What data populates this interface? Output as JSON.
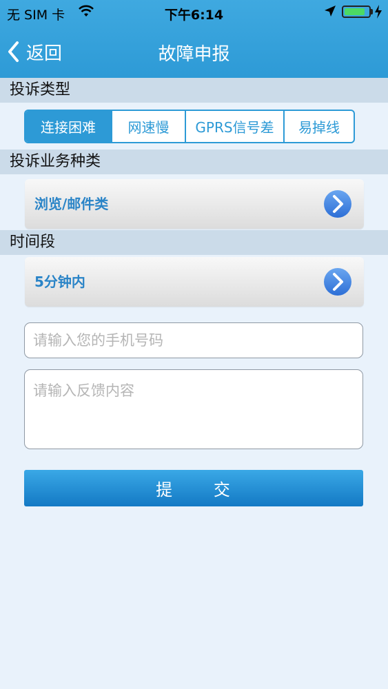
{
  "status_bar": {
    "carrier": "无 SIM 卡",
    "time": "下午6:14",
    "battery_level": 0.85,
    "battery_color": "#4cd964"
  },
  "nav": {
    "back_label": "返回",
    "title": "故障申报",
    "back_icon": "chevron-left-icon"
  },
  "complaint_type": {
    "heading": "投诉类型",
    "options": [
      "连接困难",
      "网速慢",
      "GPRS信号差",
      "易掉线"
    ],
    "selected_index": 0
  },
  "service_type": {
    "heading": "投诉业务种类",
    "value": "浏览/邮件类",
    "icon": "chevron-right-circle-icon"
  },
  "time_period": {
    "heading": "时间段",
    "value": "5分钟内",
    "icon": "chevron-right-circle-icon"
  },
  "phone_input": {
    "placeholder": "请输入您的手机号码",
    "value": ""
  },
  "feedback_input": {
    "placeholder": "请输入反馈内容",
    "value": ""
  },
  "submit_label": "提      交",
  "colors": {
    "brand_blue": "#2d9ad6",
    "select_text": "#2a84c7",
    "section_bg": "#cbdbe9",
    "page_bg": "#e9f2fb"
  }
}
